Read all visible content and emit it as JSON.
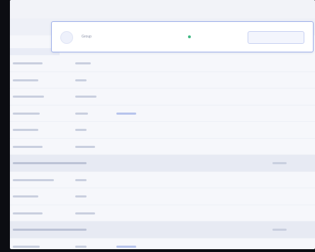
{
  "card": {
    "label": "Group",
    "value": "",
    "status": "",
    "button": ""
  },
  "rows": [
    {
      "name": "",
      "val": "",
      "link": "",
      "right": ""
    },
    {
      "name": "",
      "val": "",
      "link": "",
      "right": ""
    },
    {
      "name": "",
      "val": "",
      "link": "",
      "right": ""
    },
    {
      "name": "",
      "val": "",
      "link": "",
      "right": ""
    },
    {
      "name": "",
      "val": "",
      "link": "",
      "right": ""
    },
    {
      "name": "",
      "val": "",
      "link": "",
      "right": ""
    },
    {
      "name": "",
      "val": "",
      "link": "",
      "right": ""
    },
    {
      "name": "",
      "val": "",
      "link": "",
      "right": ""
    },
    {
      "name": "",
      "val": "",
      "link": "",
      "right": ""
    },
    {
      "name": "",
      "val": "",
      "link": "",
      "right": ""
    },
    {
      "name": "",
      "val": "",
      "link": "",
      "right": ""
    },
    {
      "name": "",
      "val": "",
      "link": "",
      "right": ""
    }
  ],
  "colors": {
    "accent": "#5f78d6",
    "status_ok": "#41b883",
    "card_border": "#9fb0ea"
  }
}
